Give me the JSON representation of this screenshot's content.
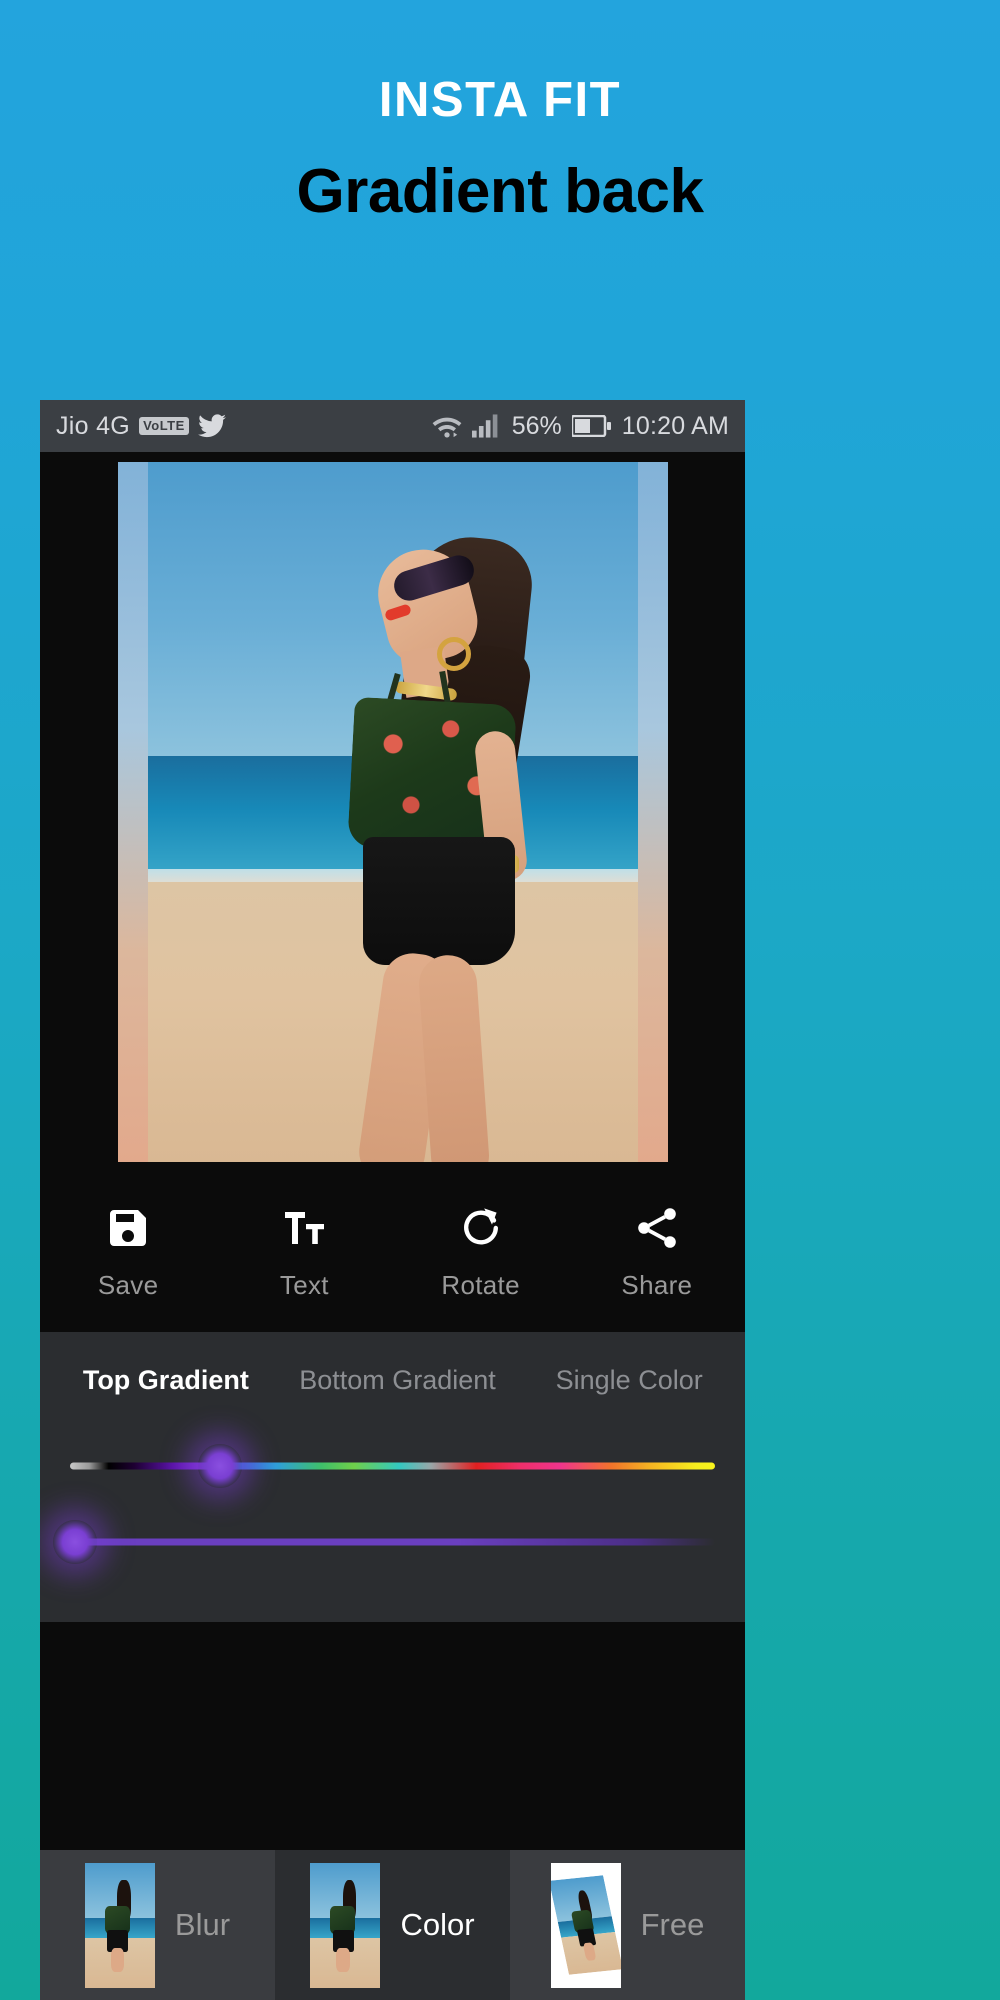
{
  "promo": {
    "title": "INSTA FIT",
    "subtitle": "Gradient back",
    "title_color": "#ffffff",
    "subtitle_color": "#000000",
    "bg_top_color": "#23a4dd",
    "bg_bottom_color": "#12a89c"
  },
  "statusbar": {
    "carrier": "Jio 4G",
    "volte_badge": "VoLTE",
    "twitter_icon": "twitter-icon",
    "wifi_icon": "wifi-icon",
    "signal_icon": "signal-bars-icon",
    "battery_percent": "56%",
    "battery_icon": "battery-icon",
    "time": "10:20 AM",
    "bg_color": "#3b3f44",
    "text_color": "#d8dade"
  },
  "toolbar": {
    "items": [
      {
        "label": "Save",
        "icon": "floppy-disk-icon"
      },
      {
        "label": "Text",
        "icon": "text-size-icon"
      },
      {
        "label": "Rotate",
        "icon": "rotate-clockwise-icon"
      },
      {
        "label": "Share",
        "icon": "share-icon"
      }
    ],
    "bg_color": "#0b0b0b",
    "label_color": "#9a9a9a"
  },
  "gradient_panel": {
    "tabs": [
      {
        "label": "Top Gradient",
        "active": true
      },
      {
        "label": "Bottom Gradient",
        "active": false
      },
      {
        "label": "Single Color",
        "active": false
      }
    ],
    "sliders": [
      {
        "name": "hue-slider",
        "type": "rainbow",
        "value_percent": 23,
        "thumb_color": "#7a3fd2"
      },
      {
        "name": "saturation-slider",
        "type": "purple",
        "value_percent": 3,
        "thumb_color": "#7a3fd2"
      }
    ],
    "bg_color": "#2b2d30",
    "active_tab_color": "#ffffff",
    "inactive_tab_color": "#8d8f93"
  },
  "bottom_nav": {
    "items": [
      {
        "label": "Blur",
        "active": false,
        "thumb": "photo-thumbnail-blur"
      },
      {
        "label": "Color",
        "active": true,
        "thumb": "photo-thumbnail-color"
      },
      {
        "label": "Free",
        "active": false,
        "thumb": "photo-thumbnail-free"
      }
    ],
    "active_bg": "#2b2d30",
    "inactive_bg": "#3a3c40",
    "active_label_color": "#ffffff",
    "inactive_label_color": "#9a9a9a"
  },
  "canvas": {
    "name": "photo-canvas",
    "description": "Woman in floral top and black shorts on a beach with gradient background frame",
    "frame_bg": "#0b0b0b"
  }
}
